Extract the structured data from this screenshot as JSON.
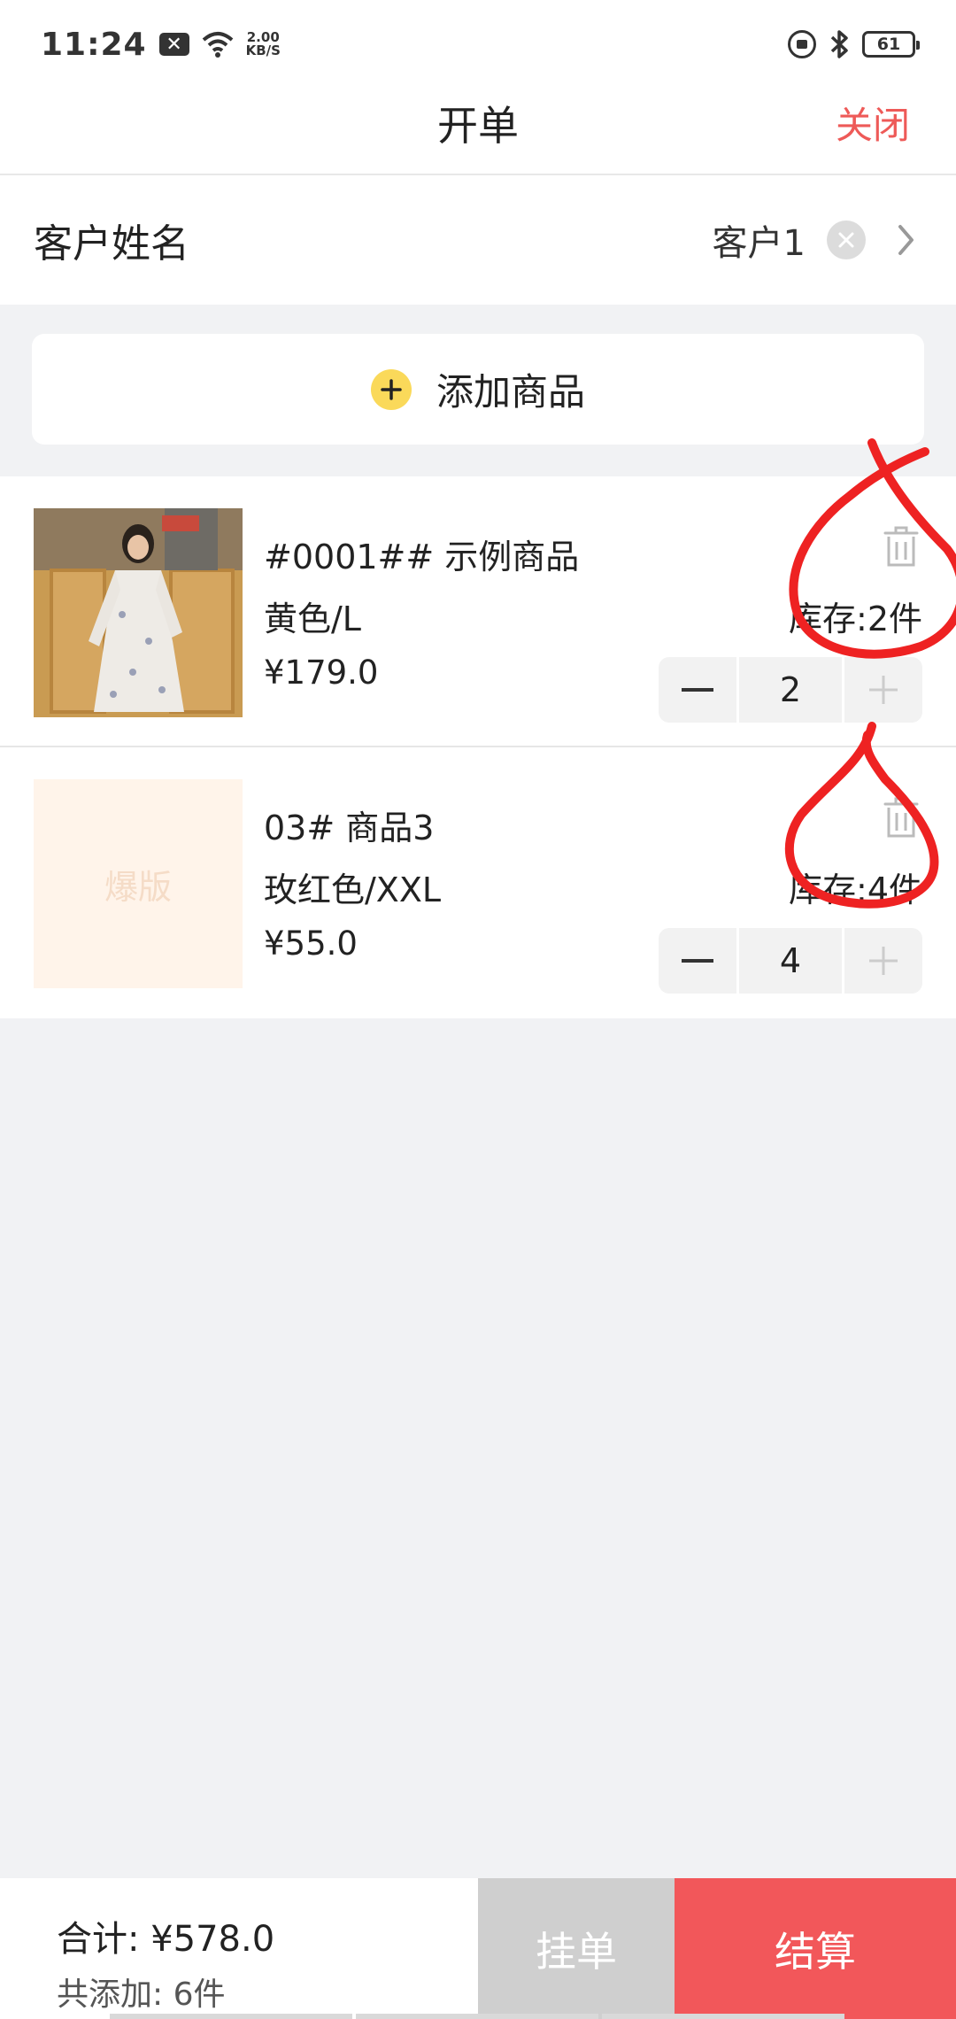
{
  "status_bar": {
    "time": "11:24",
    "x_badge": "✕",
    "net_speed_value": "2.00",
    "net_speed_unit": "KB/S",
    "battery": "61"
  },
  "nav": {
    "title": "开单",
    "close_label": "关闭"
  },
  "customer": {
    "label": "客户姓名",
    "value": "客户1"
  },
  "add_product": {
    "label": "添加商品"
  },
  "products": [
    {
      "name": "#0001## 示例商品",
      "spec": "黄色/L",
      "price": "¥179.0",
      "stock": "库存:2件",
      "quantity": "2",
      "thumbnail": "photo"
    },
    {
      "name": "03# 商品3",
      "spec": "玫红色/XXL",
      "price": "¥55.0",
      "stock": "库存:4件",
      "quantity": "4",
      "thumbnail": "placeholder",
      "placeholder_text": "爆版"
    }
  ],
  "footer": {
    "total": "合计: ¥578.0",
    "count": "共添加: 6件",
    "hold_label": "挂单",
    "checkout_label": "结算"
  },
  "colors": {
    "accent_red": "#f2575a",
    "close_red": "#ee5a58",
    "plus_yellow": "#fad95a",
    "annotation_red": "#ee2222"
  }
}
